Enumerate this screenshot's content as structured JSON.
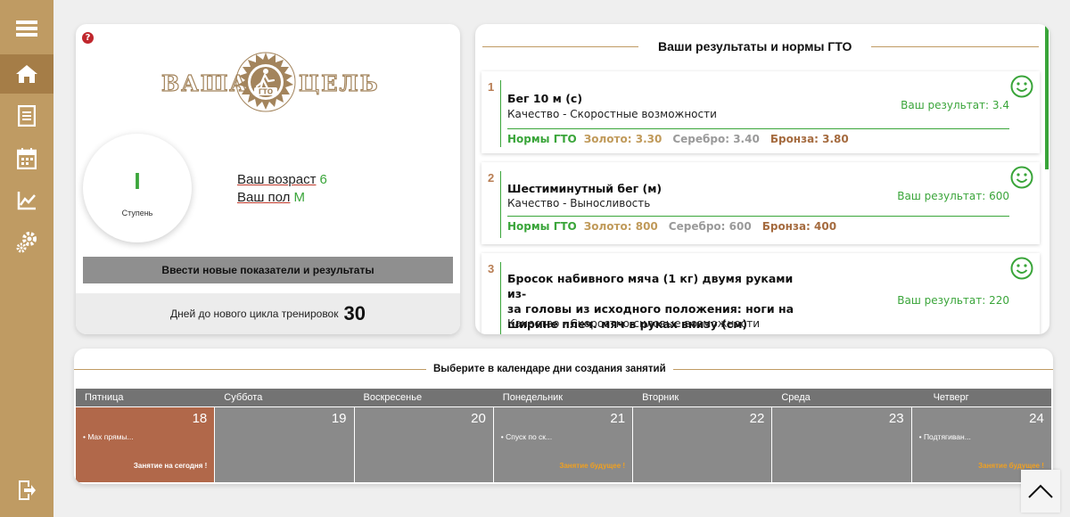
{
  "sidebar": {
    "items": [
      {
        "icon": "menu-icon"
      },
      {
        "icon": "home-icon",
        "active": true
      },
      {
        "icon": "document-icon"
      },
      {
        "icon": "calendar-icon"
      },
      {
        "icon": "chart-icon"
      },
      {
        "icon": "settings-icon"
      }
    ],
    "logout_icon": "logout-icon",
    "color": "#bf9b63",
    "active_color": "#a57d47"
  },
  "profile": {
    "help_label": "?",
    "logo": {
      "left_word": "ВАША",
      "right_word": "ЦЕЛЬ",
      "emblem_text": "ГТО"
    },
    "stage_value": "I",
    "stage_label": "Ступень",
    "age_label": "Ваш возраст",
    "age_value": "6",
    "gender_label": "Ваш пол",
    "gender_value": "М",
    "enter_button": "Ввести новые показатели и результаты",
    "days_label": "Дней до нового цикла тренировок",
    "days_value": "30"
  },
  "results": {
    "title": "Ваши результаты и нормы ГТО",
    "items": [
      {
        "index": "1",
        "title": "Бег 10 м (с)",
        "quality": "Качество - Скоростные возможности",
        "norms_label": "Нормы ГТО",
        "gold": "Золото: 3.30",
        "silver": "Серебро: 3.40",
        "bronze": "Бронза: 3.80",
        "result": "Ваш результат: 3.4"
      },
      {
        "index": "2",
        "title": "Шестиминутный бег (м)",
        "quality": "Качество - Выносливость",
        "norms_label": "Нормы ГТО",
        "gold": "Золото: 800",
        "silver": "Серебро: 600",
        "bronze": "Бронза: 400",
        "result": "Ваш результат: 600"
      },
      {
        "index": "3",
        "title_lines": [
          "Бросок набивного мяча (1 кг) двумя руками из-",
          "за головы из исходного положения: ноги на",
          "ширине плеч. мяч в руках внизу (см)"
        ],
        "quality": "Качество - Скоростно-силовые возможности",
        "result": "Ваш результат: 220"
      }
    ]
  },
  "calendar": {
    "title": "Выберите в календаре дни создания занятий",
    "days": [
      {
        "name": "Пятница",
        "num": "18",
        "event": "Max прямы...",
        "note": "Занятие на сегодня !",
        "state": "today"
      },
      {
        "name": "Суббота",
        "num": "19",
        "event": "",
        "note": "",
        "state": ""
      },
      {
        "name": "Воскресенье",
        "num": "20",
        "event": "",
        "note": "",
        "state": ""
      },
      {
        "name": "Понедельник",
        "num": "21",
        "event": "Спуск по ск...",
        "note": "Занятие будущее !",
        "state": "future"
      },
      {
        "name": "Вторник",
        "num": "22",
        "event": "",
        "note": "",
        "state": ""
      },
      {
        "name": "Среда",
        "num": "23",
        "event": "",
        "note": "",
        "state": ""
      },
      {
        "name": "Четверг",
        "num": "24",
        "event": "Подтягиван...",
        "note": "Занятие будущее !",
        "state": "future"
      }
    ]
  },
  "scroll_top_icon": "chevron-up-icon",
  "colors": {
    "accent": "#bf9b63",
    "green": "#3aa53a",
    "today": "#b1684a",
    "future_note": "#f0a020"
  }
}
